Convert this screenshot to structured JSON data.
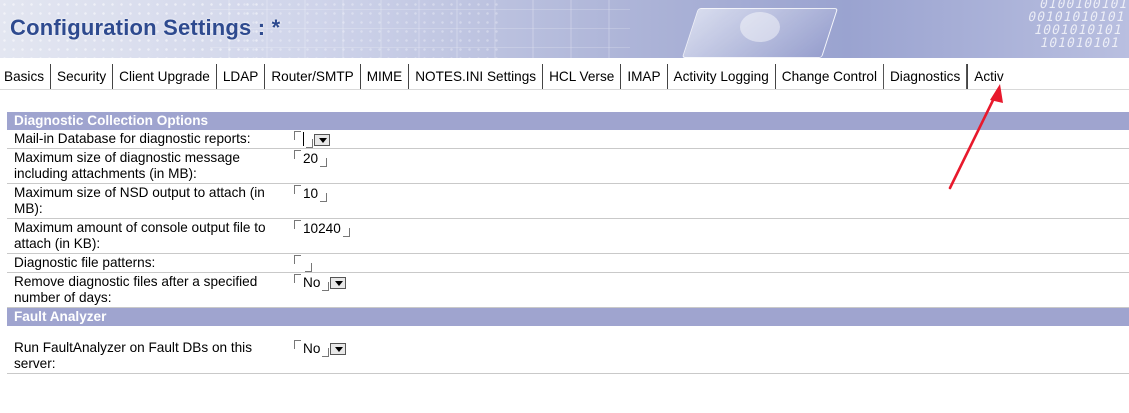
{
  "header": {
    "title": "Configuration Settings : *"
  },
  "banner": {
    "binary_text": "0100100101\n00101010101\n1001010101\n101010101"
  },
  "tabs": [
    {
      "label": "Basics",
      "active": false
    },
    {
      "label": "Security",
      "active": false
    },
    {
      "label": "Client Upgrade",
      "active": false
    },
    {
      "label": "LDAP",
      "active": false
    },
    {
      "label": "Router/SMTP",
      "active": false
    },
    {
      "label": "MIME",
      "active": false
    },
    {
      "label": "NOTES.INI Settings",
      "active": false
    },
    {
      "label": "HCL Verse",
      "active": false
    },
    {
      "label": "IMAP",
      "active": false
    },
    {
      "label": "Activity Logging",
      "active": false
    },
    {
      "label": "Change Control",
      "active": false
    },
    {
      "label": "Diagnostics",
      "active": true
    },
    {
      "label": "Activ",
      "active": false
    }
  ],
  "sections": {
    "diagnostic": {
      "header": "Diagnostic Collection Options",
      "rows": [
        {
          "label": "Mail-in Database for diagnostic reports:",
          "value": ""
        },
        {
          "label": "Maximum size of diagnostic message including attachments (in MB):",
          "value": "20"
        },
        {
          "label": "Maximum size of NSD output to attach (in MB):",
          "value": "10"
        },
        {
          "label": "Maximum amount of console output file to attach (in KB):",
          "value": "10240"
        },
        {
          "label": "Diagnostic file patterns:",
          "value": ""
        },
        {
          "label": "Remove diagnostic files after a specified number of days:",
          "value": "No"
        }
      ]
    },
    "fault": {
      "header": "Fault Analyzer",
      "rows": [
        {
          "label": "Run FaultAnalyzer on Fault DBs on this server:",
          "value": "No"
        }
      ]
    }
  },
  "colors": {
    "title": "#2e4a8f",
    "section_header_bg": "#9fa4cf",
    "annotation_arrow": "#e8192c"
  },
  "icons": {
    "field_open": "field-bracket-open-icon",
    "field_close": "field-bracket-close-icon",
    "dropdown": "dropdown-arrow-icon",
    "annotation": "red-arrow-icon"
  }
}
